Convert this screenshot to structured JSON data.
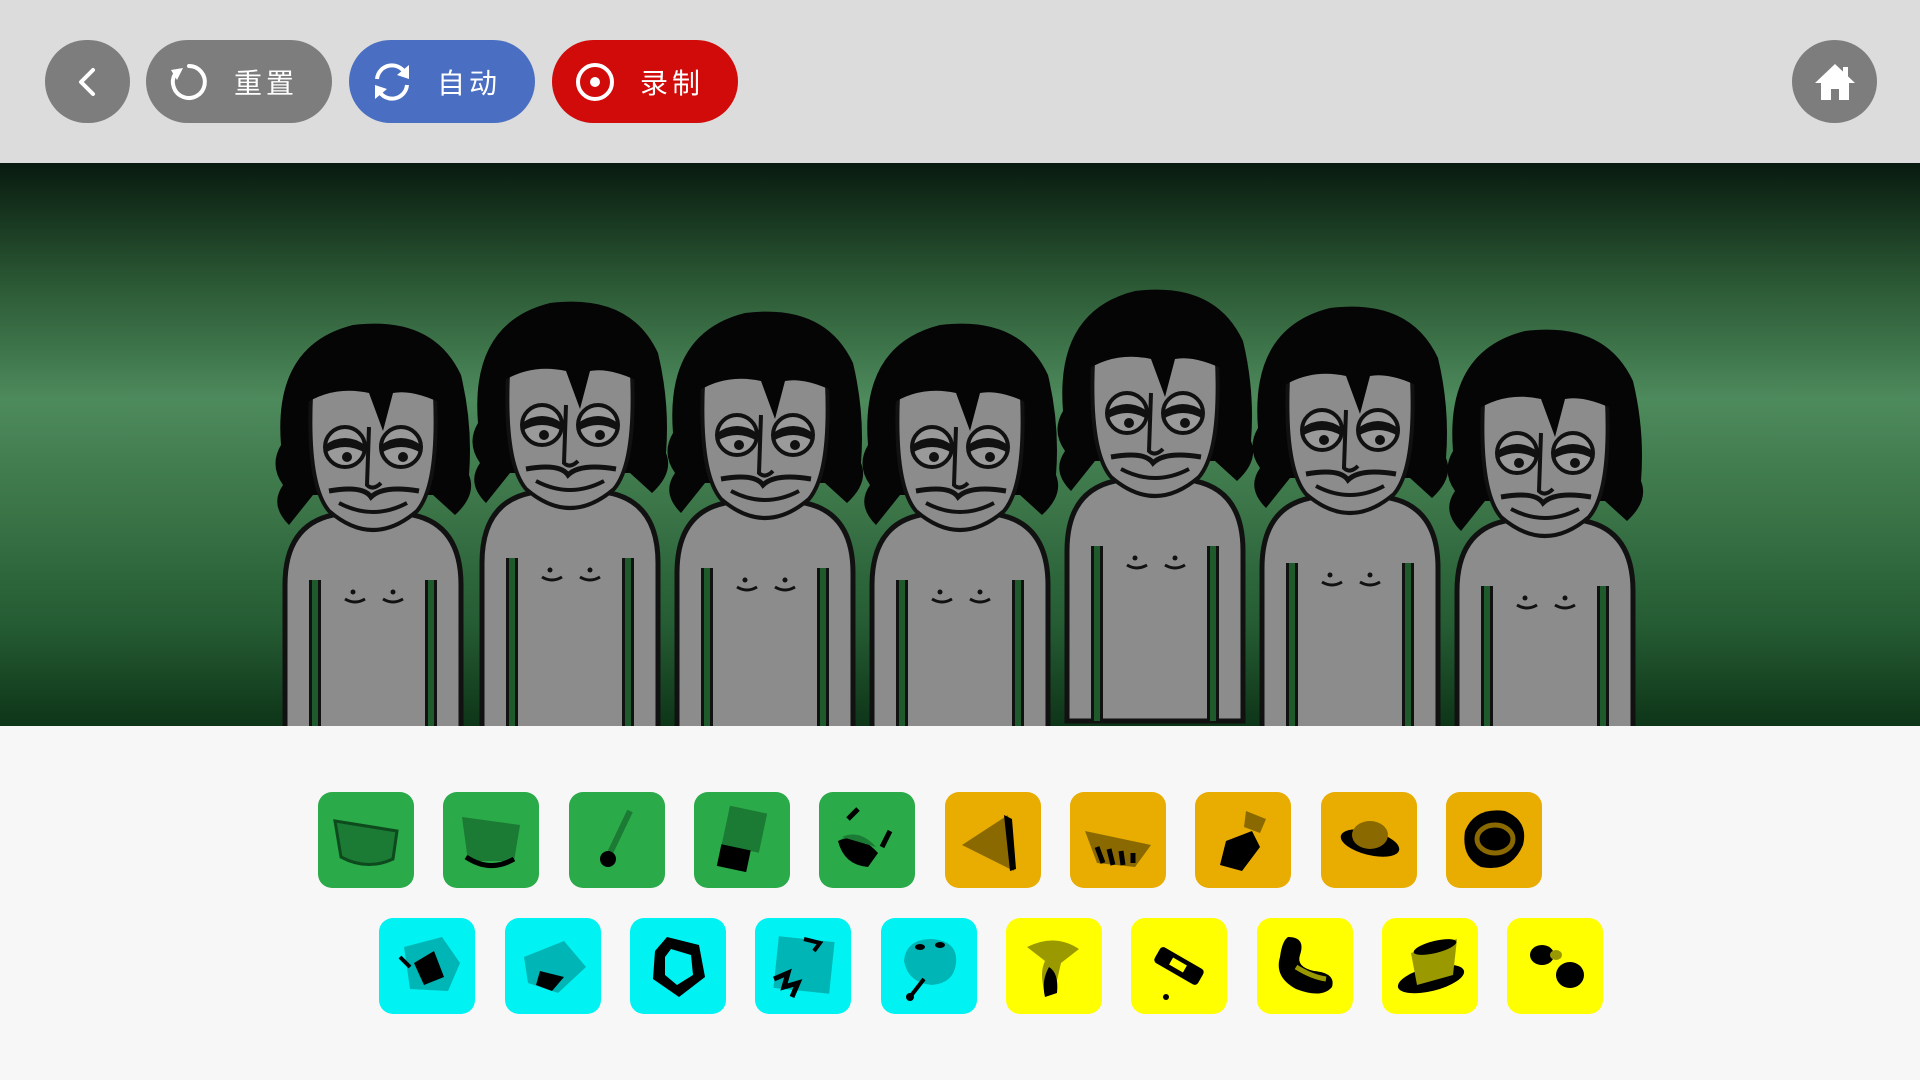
{
  "toolbar": {
    "back_icon": "chevron-left-icon",
    "reset_label": "重置",
    "reset_icon": "reset-icon",
    "auto_label": "自动",
    "auto_icon": "sync-icon",
    "record_label": "录制",
    "record_icon": "record-icon",
    "home_icon": "home-icon"
  },
  "stage": {
    "character_count": 7,
    "colors": {
      "top_bar": "#dcdcdc",
      "stage_dark": "#081a0f",
      "stage_light": "#4d8a5c",
      "character_body": "#8c8c8c"
    }
  },
  "palette": {
    "row1": [
      {
        "icon": "green-sound-1-icon",
        "color": "#2aaa48"
      },
      {
        "icon": "green-sound-2-icon",
        "color": "#2aaa48"
      },
      {
        "icon": "green-sound-3-icon",
        "color": "#2aaa48"
      },
      {
        "icon": "green-sound-4-icon",
        "color": "#2aaa48"
      },
      {
        "icon": "green-sound-5-icon",
        "color": "#2aaa48"
      },
      {
        "icon": "orange-sound-1-icon",
        "color": "#e8ad00"
      },
      {
        "icon": "orange-sound-2-icon",
        "color": "#e8ad00"
      },
      {
        "icon": "orange-sound-3-icon",
        "color": "#e8ad00"
      },
      {
        "icon": "orange-sound-4-icon",
        "color": "#e8ad00"
      },
      {
        "icon": "orange-sound-5-icon",
        "color": "#e8ad00"
      }
    ],
    "row2": [
      {
        "icon": "cyan-sound-1-icon",
        "color": "#00f2f2"
      },
      {
        "icon": "cyan-sound-2-icon",
        "color": "#00f2f2"
      },
      {
        "icon": "cyan-sound-3-icon",
        "color": "#00f2f2"
      },
      {
        "icon": "cyan-sound-4-icon",
        "color": "#00f2f2"
      },
      {
        "icon": "cyan-sound-5-icon",
        "color": "#00f2f2"
      },
      {
        "icon": "yellow-sound-1-icon",
        "color": "#ffff00"
      },
      {
        "icon": "yellow-sound-2-icon",
        "color": "#ffff00"
      },
      {
        "icon": "yellow-sound-3-icon",
        "color": "#ffff00"
      },
      {
        "icon": "yellow-sound-4-icon",
        "color": "#ffff00"
      },
      {
        "icon": "yellow-sound-5-icon",
        "color": "#ffff00"
      }
    ]
  }
}
